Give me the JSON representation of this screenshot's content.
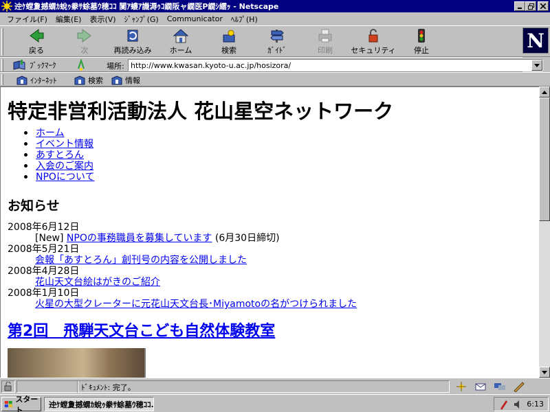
{
  "window": {
    "title": "迚ｹ螳夐撼蝟ｶ蛻ｩ豢ｻ蜍墓ｳ穂ｺｺ 闃ｱ螻ｱ譏溽ｩｺ繝阪ャ繝医Ρ繝ｼ繧ｯ - Netscape"
  },
  "menubar": {
    "items": [
      "ファイル(F)",
      "編集(E)",
      "表示(V)",
      "ｼﾞｬﾝﾌﾟ(G)",
      "Communicator",
      "ﾍﾙﾌﾟ(H)"
    ]
  },
  "toolbar": {
    "back": "戻る",
    "forward": "次",
    "reload": "再読み込み",
    "home": "ホーム",
    "search": "検索",
    "guide": "ｶﾞｲﾄﾞ",
    "print": "印刷",
    "security": "セキュリティ",
    "stop": "停止",
    "logo": "N"
  },
  "location": {
    "bookmarks_label": "ﾌﾞｯｸﾏｰｸ",
    "field_label": "場所:",
    "url": "http://www.kwasan.kyoto-u.ac.jp/hosizora/"
  },
  "personal_toolbar": {
    "items": [
      "ｲﾝﾀｰﾈｯﾄ",
      "検索",
      "情報"
    ]
  },
  "page": {
    "title": "特定非営利活動法人 花山星空ネットワーク",
    "nav": [
      "ホーム",
      "イベント情報",
      "あすとろん",
      "入会のご案内",
      "NPOについて"
    ],
    "news_heading": "お知らせ",
    "news": [
      {
        "date": "2008年6月12日",
        "prefix": "[New] ",
        "link": "NPOの事務職員を募集しています",
        "suffix": " (6月30日締切)"
      },
      {
        "date": "2008年5月21日",
        "prefix": "",
        "link": "会報「あすとろん」創刊号の内容を公開しました",
        "suffix": ""
      },
      {
        "date": "2008年4月28日",
        "prefix": "",
        "link": "花山天文台絵はがきのご紹介",
        "suffix": ""
      },
      {
        "date": "2008年1月10日",
        "prefix": "",
        "link": "火星の大型クレーターに元花山天文台長･Miyamotoの名がつけられました",
        "suffix": ""
      }
    ],
    "event_heading": "第2回　飛騨天文台こども自然体験教室"
  },
  "status": {
    "text": "ﾄﾞｷｭﾒﾝﾄ: 完了。"
  },
  "taskbar": {
    "start_label": "スタート",
    "task_label": "迚ｹ螳夐撼蝟ｶ蛻ｩ豢ｻ蜍墓ｳ穂ｺｺ...",
    "clock": "6:13"
  },
  "colors": {
    "titlebar": "#000080",
    "link": "#0000ee",
    "chrome": "#c0c0c0"
  }
}
